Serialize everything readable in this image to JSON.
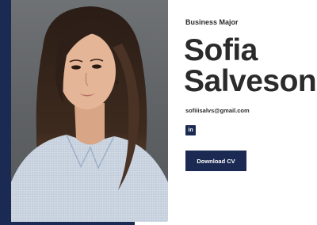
{
  "profile": {
    "subtitle": "Business Major",
    "first_name": "Sofia",
    "last_name": "Salveson",
    "email": "sofiiisalvs@gmail.com",
    "linkedin_icon_text": "in",
    "download_cv_label": "Download CV"
  },
  "colors": {
    "accent": "#1b2a52",
    "text": "#2b2b2b",
    "background": "#ffffff"
  },
  "icons": {
    "social": "linkedin-icon"
  }
}
